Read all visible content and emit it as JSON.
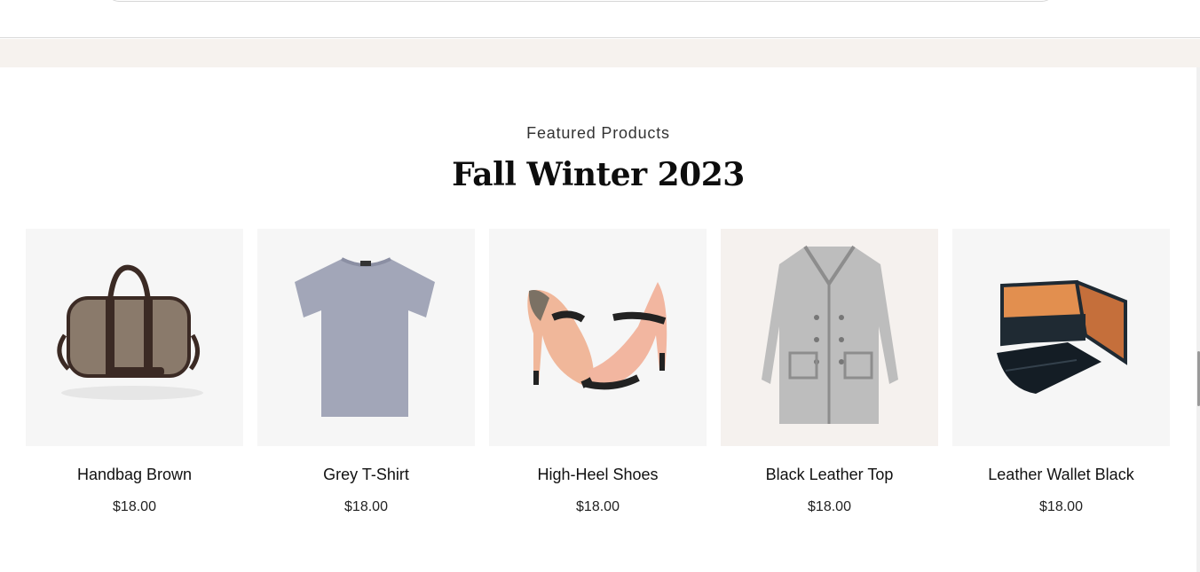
{
  "section": {
    "eyebrow": "Featured Products",
    "title": "Fall Winter 2023"
  },
  "products": [
    {
      "name": "Handbag Brown",
      "price": "$18.00",
      "icon": "handbag-icon"
    },
    {
      "name": "Grey T-Shirt",
      "price": "$18.00",
      "icon": "tshirt-icon"
    },
    {
      "name": "High-Heel Shoes",
      "price": "$18.00",
      "icon": "shoes-icon"
    },
    {
      "name": "Black Leather Top",
      "price": "$18.00",
      "icon": "coat-icon"
    },
    {
      "name": "Leather Wallet Black",
      "price": "$18.00",
      "icon": "wallet-icon"
    }
  ],
  "colors": {
    "band": "#f6f2ee",
    "card_bg": "#f6f6f6",
    "text": "#111111"
  }
}
